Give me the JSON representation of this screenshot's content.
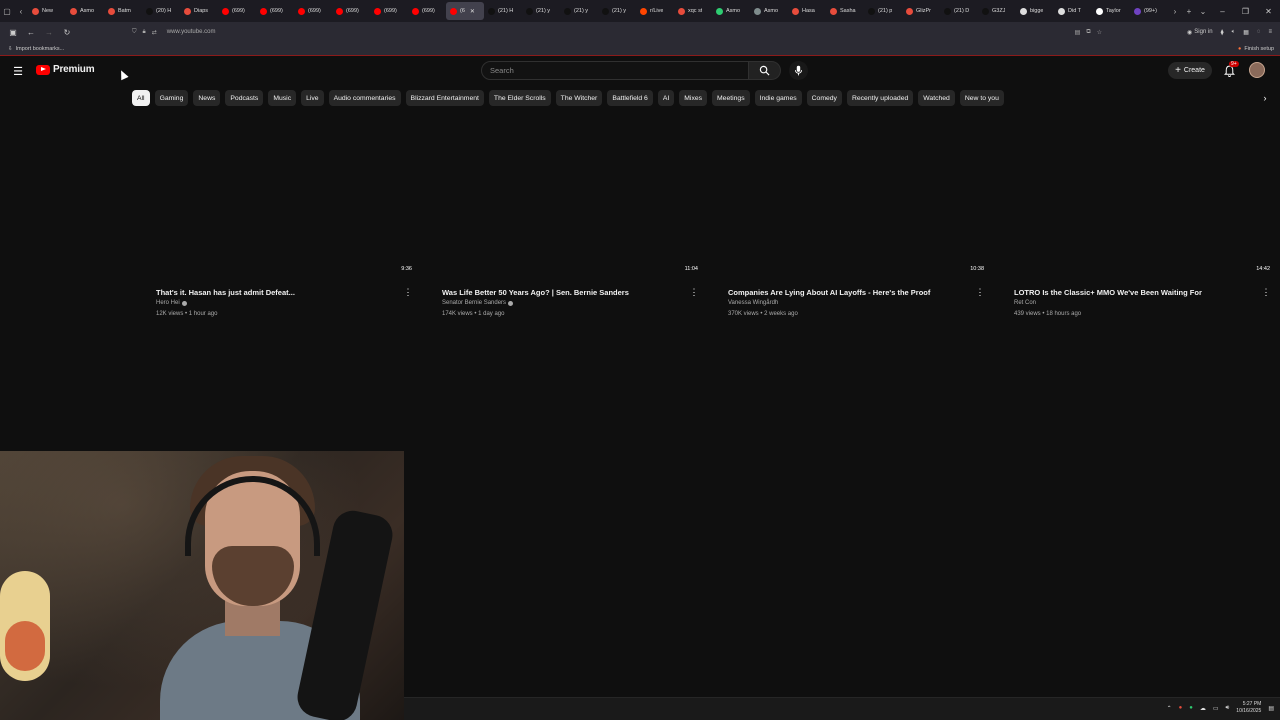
{
  "browser": {
    "tabs": [
      {
        "label": "New",
        "color": "#e74c3c"
      },
      {
        "label": "Asmo",
        "color": "#e74c3c"
      },
      {
        "label": "Batm",
        "color": "#e74c3c"
      },
      {
        "label": "(20) H",
        "color": "#111111"
      },
      {
        "label": "Diaps",
        "color": "#e74c3c"
      },
      {
        "label": "(699)",
        "color": "#ff0000"
      },
      {
        "label": "(699)",
        "color": "#ff0000"
      },
      {
        "label": "(699)",
        "color": "#ff0000"
      },
      {
        "label": "(699)",
        "color": "#ff0000"
      },
      {
        "label": "(699)",
        "color": "#ff0000"
      },
      {
        "label": "(699)",
        "color": "#ff0000"
      },
      {
        "label": "(6",
        "color": "#ff0000",
        "active": true
      },
      {
        "label": "(21) H",
        "color": "#111111"
      },
      {
        "label": "(21) y",
        "color": "#111111"
      },
      {
        "label": "(21) y",
        "color": "#111111"
      },
      {
        "label": "(21) y",
        "color": "#111111"
      },
      {
        "label": "r/Live",
        "color": "#ff4500"
      },
      {
        "label": "xqc st",
        "color": "#e74c3c"
      },
      {
        "label": "Asmo",
        "color": "#2ecc71"
      },
      {
        "label": "Asmo",
        "color": "#7f8c8d"
      },
      {
        "label": "Hasa",
        "color": "#e74c3c"
      },
      {
        "label": "Sasha",
        "color": "#e74c3c"
      },
      {
        "label": "(21) p",
        "color": "#111111"
      },
      {
        "label": "GlizPr",
        "color": "#e74c3c"
      },
      {
        "label": "(21) D",
        "color": "#111111"
      },
      {
        "label": "G3ZJ",
        "color": "#111111"
      },
      {
        "label": "bigge",
        "color": "#dddddd"
      },
      {
        "label": "Did T",
        "color": "#dddddd"
      },
      {
        "label": "Taylor",
        "color": "#ffffff"
      },
      {
        "label": "(99+)",
        "color": "#6f42c1"
      }
    ],
    "url": "www.youtube.com",
    "sign_in": "Sign in",
    "bookmarks_import": "Import bookmarks...",
    "finish_setup": "Finish setup"
  },
  "youtube": {
    "logo_text": "Premium",
    "search_placeholder": "Search",
    "create_label": "Create",
    "notif_badge": "9+",
    "chips": [
      "All",
      "Gaming",
      "News",
      "Podcasts",
      "Music",
      "Live",
      "Audio commentaries",
      "Blizzard Entertainment",
      "The Elder Scrolls",
      "The Witcher",
      "Battlefield 6",
      "AI",
      "Mixes",
      "Meetings",
      "Indie games",
      "Comedy",
      "Recently uploaded",
      "Watched",
      "New to you"
    ],
    "videos": [
      {
        "title": "That's it. Hasan has just admit Defeat...",
        "channel": "Hero Hei",
        "verified": true,
        "meta": "12K views • 1 hour ago",
        "duration": "9:36"
      },
      {
        "title": "Was Life Better 50 Years Ago? | Sen. Bernie Sanders",
        "channel": "Senator Bernie Sanders",
        "verified": true,
        "meta": "174K views • 1 day ago",
        "duration": "11:04"
      },
      {
        "title": "Companies Are Lying About AI Layoffs - Here's the Proof",
        "channel": "Vanessa Wingårdh",
        "verified": false,
        "meta": "370K views • 2 weeks ago",
        "duration": "10:38"
      },
      {
        "title": "LOTRO Is the Classic+ MMO We've Been Waiting For",
        "channel": "Ret Con",
        "verified": false,
        "meta": "439 views • 18 hours ago",
        "duration": "14:42"
      }
    ]
  },
  "taskbar": {
    "time": "5:27 PM",
    "date": "10/16/2025"
  }
}
